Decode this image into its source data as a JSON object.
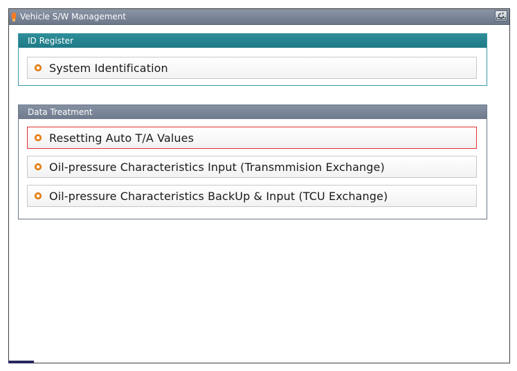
{
  "window": {
    "title": "Vehicle S/W Management",
    "retry_label": "Retry",
    "retry_icon": "retry-icon"
  },
  "id_register": {
    "header": "ID Register",
    "items": [
      {
        "label": "System Identification",
        "icon": "orange-bullet-icon"
      }
    ]
  },
  "data_treatment": {
    "header": "Data Treatment",
    "items": [
      {
        "label": "Resetting Auto T/A Values",
        "icon": "orange-bullet-icon",
        "selected": true
      },
      {
        "label": "Oil-pressure Characteristics Input (Transmmision Exchange)",
        "icon": "orange-bullet-icon",
        "selected": false
      },
      {
        "label": "Oil-pressure Characteristics BackUp & Input (TCU Exchange)",
        "icon": "orange-bullet-icon",
        "selected": false
      }
    ]
  },
  "colors": {
    "title_bar": "#7a8597",
    "id_header": "#2a8894",
    "data_header": "#7b8799",
    "selected_border": "#e03030",
    "bullet": "#f08a1c"
  }
}
